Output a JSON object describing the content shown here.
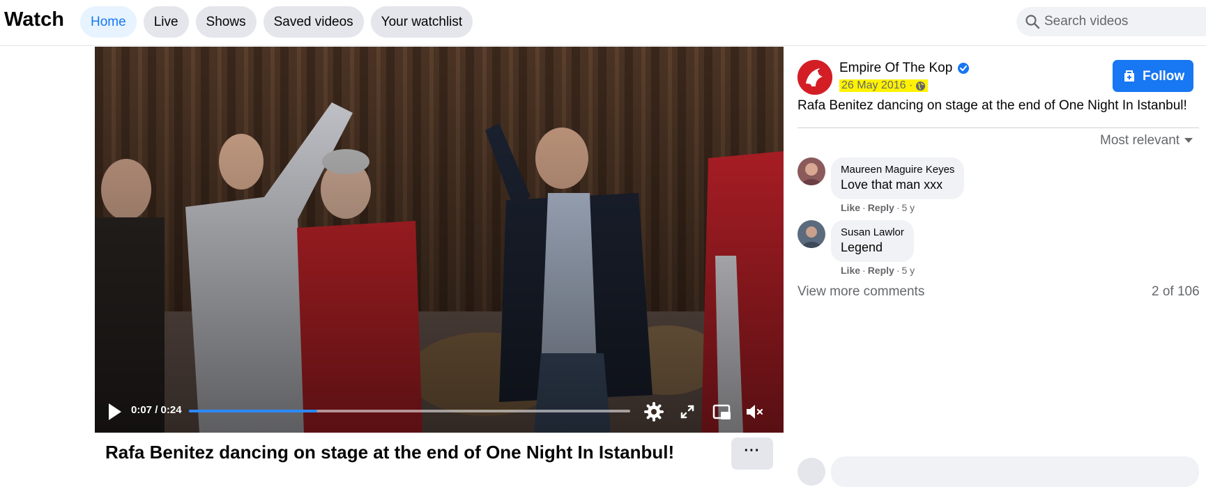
{
  "header": {
    "brand": "Watch",
    "tabs": [
      {
        "label": "Home",
        "active": true
      },
      {
        "label": "Live",
        "active": false
      },
      {
        "label": "Shows",
        "active": false
      },
      {
        "label": "Saved videos",
        "active": false
      },
      {
        "label": "Your watchlist",
        "active": false
      }
    ],
    "search_placeholder": "Search videos"
  },
  "player": {
    "time": "0:07 / 0:24",
    "progress_fraction": 0.29,
    "icons": [
      "play-icon",
      "settings-icon",
      "fullscreen-icon",
      "picture-in-picture-icon",
      "mute-icon"
    ]
  },
  "video": {
    "title": "Rafa Benitez dancing on stage at the end of One Night In Istanbul!",
    "more_label": "···"
  },
  "post": {
    "page_name": "Empire Of The Kop",
    "date": "26 May 2016 ·",
    "follow_label": "Follow",
    "text": "Rafa Benitez dancing on stage at the end of One Night In Istanbul!"
  },
  "comments": {
    "sort_label": "Most relevant",
    "items": [
      {
        "author": "Maureen Maguire Keyes",
        "text": "Love that man xxx",
        "like": "Like",
        "reply": "Reply",
        "age": "5 y"
      },
      {
        "author": "Susan Lawlor",
        "text": "Legend",
        "like": "Like",
        "reply": "Reply",
        "age": "5 y"
      }
    ],
    "view_more": "View more comments",
    "count": "2 of 106"
  },
  "colors": {
    "accent": "#1877f2",
    "progress": "#2d88ff",
    "highlight": "#fff200",
    "tab_bg": "#e4e6eb"
  }
}
